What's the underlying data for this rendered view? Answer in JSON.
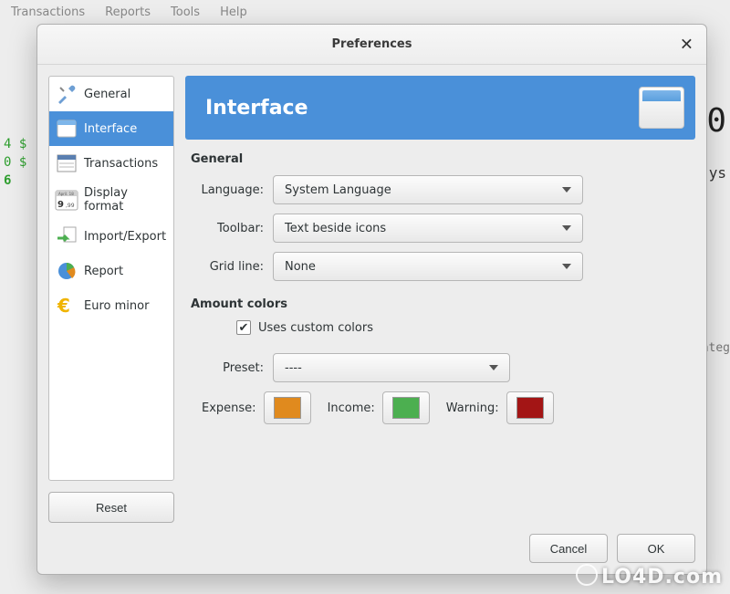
{
  "menubar": [
    "Transactions",
    "Reports",
    "Tools",
    "Help"
  ],
  "dialog": {
    "title": "Preferences",
    "close_glyph": "✕"
  },
  "sidebar": {
    "items": [
      {
        "label": "General"
      },
      {
        "label": "Interface"
      },
      {
        "label": "Transactions"
      },
      {
        "label": "Display format"
      },
      {
        "label": "Import/Export"
      },
      {
        "label": "Report"
      },
      {
        "label": "Euro minor"
      }
    ],
    "reset_label": "Reset",
    "selected_index": 1
  },
  "header": {
    "title": "Interface"
  },
  "sections": {
    "general": {
      "title": "General",
      "language_label": "Language:",
      "language_value": "System Language",
      "toolbar_label": "Toolbar:",
      "toolbar_value": "Text beside icons",
      "gridline_label": "Grid line:",
      "gridline_value": "None"
    },
    "amount_colors": {
      "title": "Amount colors",
      "checkbox_label": "Uses custom colors",
      "checkbox_checked": true,
      "preset_label": "Preset:",
      "preset_value": "----",
      "expense_label": "Expense:",
      "expense_color": "#e08a1e",
      "income_label": "Income:",
      "income_color": "#4caf50",
      "warning_label": "Warning:",
      "warning_color": "#a31515"
    }
  },
  "footer": {
    "cancel_label": "Cancel",
    "ok_label": "OK"
  },
  "background": {
    "frag1": "4 $",
    "frag2": "0 $",
    "frag3": "6",
    "frag_right_top": "0",
    "frag_right_mid": "ys",
    "frag_right_cat": "ateg"
  },
  "watermark": "LO4D.com"
}
